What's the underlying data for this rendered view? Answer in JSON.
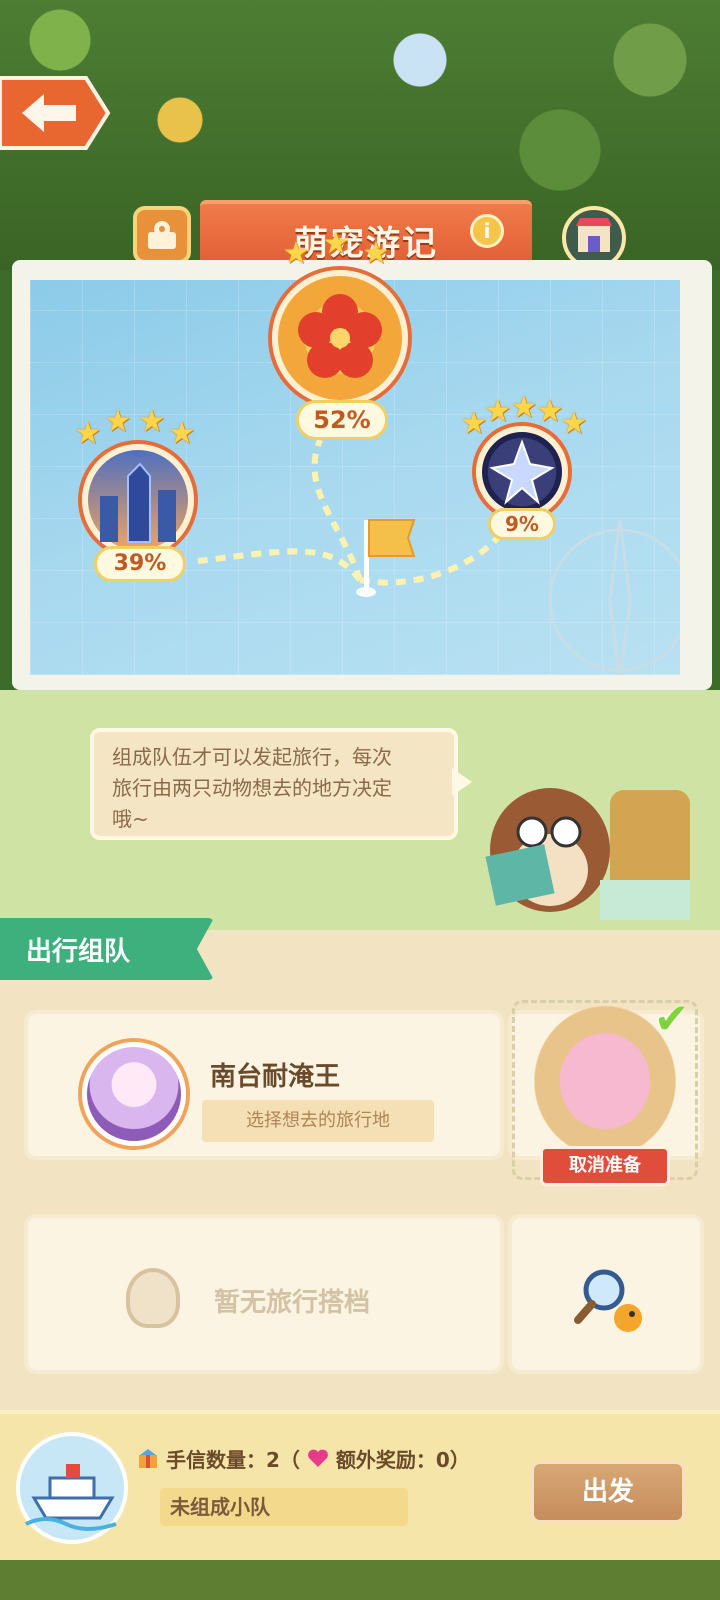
{
  "header": {
    "title": "萌宠游记",
    "back_icon": "arrow-left-icon",
    "map_icon": "map-pin-icon",
    "info_icon": "info-icon",
    "shop_icon": "shop-icon"
  },
  "map": {
    "destinations": [
      {
        "id": "city",
        "percent": "39%",
        "stars": 4,
        "icon": "city-skyline-icon"
      },
      {
        "id": "flower",
        "percent": "52%",
        "stars": 3,
        "icon": "plum-blossom-icon"
      },
      {
        "id": "crystal",
        "percent": "9%",
        "stars": 5,
        "icon": "crystal-star-icon"
      }
    ],
    "start_icon": "flag-icon"
  },
  "tip": {
    "line1": "组成队伍才可以发起旅行，每次",
    "line2": "旅行由两只动物想去的地方决定",
    "line3": "哦~"
  },
  "team": {
    "tab_label": "出行组队",
    "player": {
      "name": "南台耐淹王",
      "choose_label": "选择想去的旅行地"
    },
    "partner": {
      "cancel_label": "取消准备",
      "ready_mark": "✔"
    },
    "empty": {
      "label": "暂无旅行搭档"
    }
  },
  "footer": {
    "letters_label": "手信数量：2（",
    "bonus_label": "额外奖励：0）",
    "status": "未组成小队",
    "depart_label": "出发"
  },
  "colors": {
    "accent_orange": "#e15f35",
    "team_green": "#3eb07e",
    "cancel_red": "#e04d3b",
    "star_gold": "#ffd54a"
  }
}
